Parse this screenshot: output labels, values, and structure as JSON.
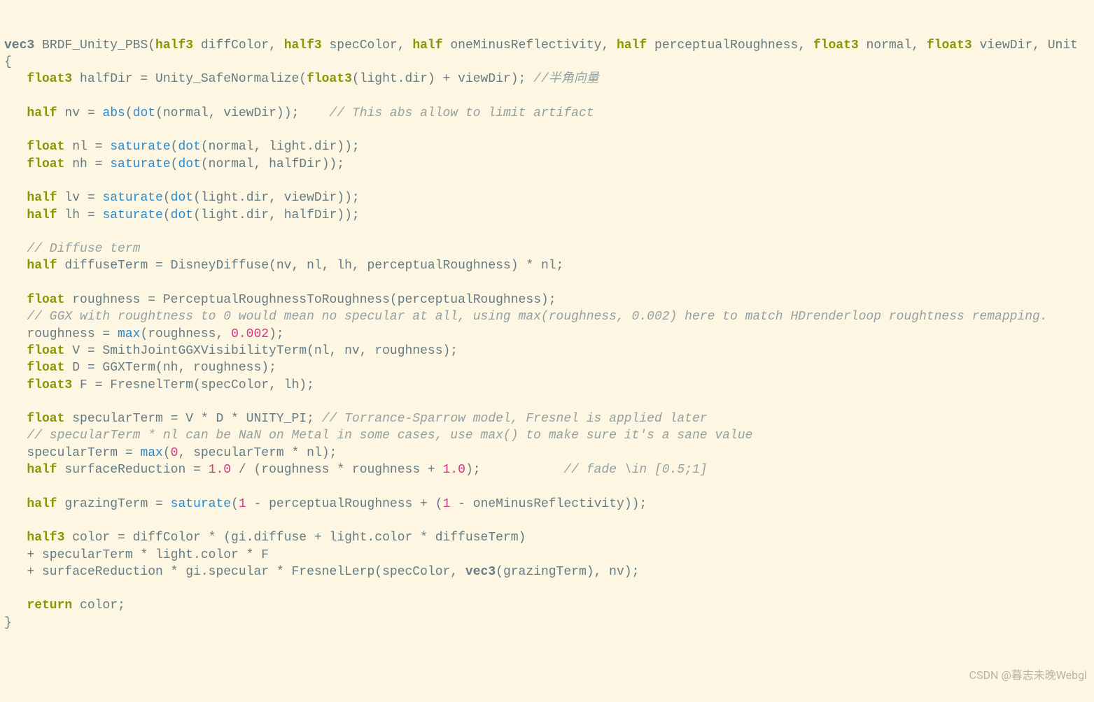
{
  "watermark": "CSDN @暮志未晚Webgl",
  "code": {
    "l01_vec3": "vec3",
    "l01_fn": " BRDF_Unity_PBS(",
    "l01_h3a": "half3",
    "l01_a1": " diffColor, ",
    "l01_h3b": "half3",
    "l01_a2": " specColor, ",
    "l01_h": "half",
    "l01_a3": " oneMinusReflectivity, ",
    "l01_h2": "half",
    "l01_a4": " perceptualRoughness, ",
    "l01_f3": "float3",
    "l01_a5": " normal, ",
    "l01_f3b": "float3",
    "l01_a6": " viewDir, Unit",
    "l02_brace": "{",
    "l03_a": "   ",
    "l03_f3": "float3",
    "l03_b": " halfDir = Unity_SafeNormalize(",
    "l03_f3b": "float3",
    "l03_c": "(light.dir) + viewDir); ",
    "l03_cm": "//半角向量",
    "l04_blank": "",
    "l05_a": "   ",
    "l05_h": "half",
    "l05_b": " nv = ",
    "l05_abs": "abs",
    "l05_c": "(",
    "l05_dot": "dot",
    "l05_d": "(normal, viewDir));    ",
    "l05_cm": "// This abs allow to limit artifact",
    "l06_blank": "",
    "l07_a": "   ",
    "l07_f": "float",
    "l07_b": " nl = ",
    "l07_sat": "saturate",
    "l07_c": "(",
    "l07_dot": "dot",
    "l07_d": "(normal, light.dir));",
    "l08_a": "   ",
    "l08_f": "float",
    "l08_b": " nh = ",
    "l08_sat": "saturate",
    "l08_c": "(",
    "l08_dot": "dot",
    "l08_d": "(normal, halfDir));",
    "l09_blank": "",
    "l10_a": "   ",
    "l10_h": "half",
    "l10_b": " lv = ",
    "l10_sat": "saturate",
    "l10_c": "(",
    "l10_dot": "dot",
    "l10_d": "(light.dir, viewDir));",
    "l11_a": "   ",
    "l11_h": "half",
    "l11_b": " lh = ",
    "l11_sat": "saturate",
    "l11_c": "(",
    "l11_dot": "dot",
    "l11_d": "(light.dir, halfDir));",
    "l12_blank": "",
    "l13_a": "   ",
    "l13_cm": "// Diffuse term",
    "l14_a": "   ",
    "l14_h": "half",
    "l14_b": " diffuseTerm = DisneyDiffuse(nv, nl, lh, perceptualRoughness) * nl;",
    "l15_blank": "",
    "l16_a": "   ",
    "l16_f": "float",
    "l16_b": " roughness = PerceptualRoughnessToRoughness(perceptualRoughness);",
    "l17_a": "   ",
    "l17_cm": "// GGX with roughtness to 0 would mean no specular at all, using max(roughness, 0.002) here to match HDrenderloop roughtness remapping.",
    "l18_a": "   roughness = ",
    "l18_max": "max",
    "l18_b": "(roughness, ",
    "l18_n": "0.002",
    "l18_c": ");",
    "l19_a": "   ",
    "l19_f": "float",
    "l19_b": " V = SmithJointGGXVisibilityTerm(nl, nv, roughness);",
    "l20_a": "   ",
    "l20_f": "float",
    "l20_b": " D = GGXTerm(nh, roughness);",
    "l21_a": "   ",
    "l21_f3": "float3",
    "l21_b": " F = FresnelTerm(specColor, lh);",
    "l22_blank": "",
    "l23_a": "   ",
    "l23_f": "float",
    "l23_b": " specularTerm = V * D * UNITY_PI; ",
    "l23_cm": "// Torrance-Sparrow model, Fresnel is applied later",
    "l24_a": "   ",
    "l24_cm": "// specularTerm * nl can be NaN on Metal in some cases, use max() to make sure it's a sane value",
    "l25_a": "   specularTerm = ",
    "l25_max": "max",
    "l25_b": "(",
    "l25_n": "0",
    "l25_c": ", specularTerm * nl);",
    "l26_a": "   ",
    "l26_h": "half",
    "l26_b": " surfaceReduction = ",
    "l26_n1": "1.0",
    "l26_c": " / (roughness * roughness + ",
    "l26_n2": "1.0",
    "l26_d": ");           ",
    "l26_cm": "// fade \\in [0.5;1]",
    "l27_blank": "",
    "l28_a": "   ",
    "l28_h": "half",
    "l28_b": " grazingTerm = ",
    "l28_sat": "saturate",
    "l28_c": "(",
    "l28_n1": "1",
    "l28_d": " - perceptualRoughness + (",
    "l28_n2": "1",
    "l28_e": " - oneMinusReflectivity));",
    "l29_blank": "",
    "l30_a": "   ",
    "l30_h3": "half3",
    "l30_b": " color = diffColor * (gi.diffuse + light.color * diffuseTerm)",
    "l31_a": "   + specularTerm * light.color * F",
    "l32_a": "   + surfaceReduction * gi.specular * FresnelLerp(specColor, ",
    "l32_v3": "vec3",
    "l32_b": "(grazingTerm), nv);",
    "l33_blank": "",
    "l34_a": "   ",
    "l34_ret": "return",
    "l34_b": " color;",
    "l35_brace": "}"
  }
}
